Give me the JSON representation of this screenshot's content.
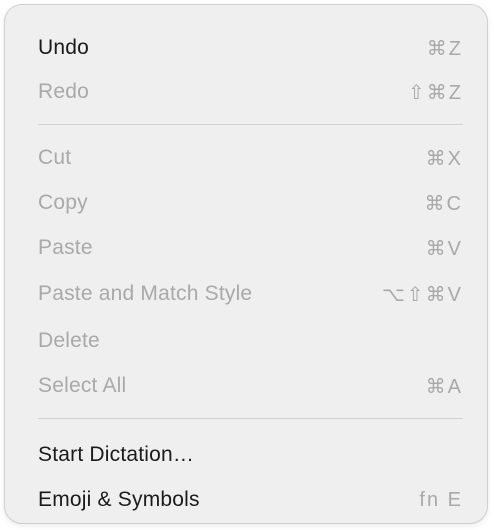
{
  "menu": {
    "items": [
      {
        "label": "Undo",
        "shortcut": "⌘Z"
      },
      {
        "label": "Redo",
        "shortcut": "⇧⌘Z"
      },
      {
        "label": "Cut",
        "shortcut": "⌘X"
      },
      {
        "label": "Copy",
        "shortcut": "⌘C"
      },
      {
        "label": "Paste",
        "shortcut": "⌘V"
      },
      {
        "label": "Paste and Match Style",
        "shortcut": "⌥⇧⌘V"
      },
      {
        "label": "Delete",
        "shortcut": ""
      },
      {
        "label": "Select All",
        "shortcut": "⌘A"
      },
      {
        "label": "Start Dictation…",
        "shortcut": ""
      },
      {
        "label": "Emoji & Symbols",
        "shortcut": "fn E"
      }
    ]
  }
}
